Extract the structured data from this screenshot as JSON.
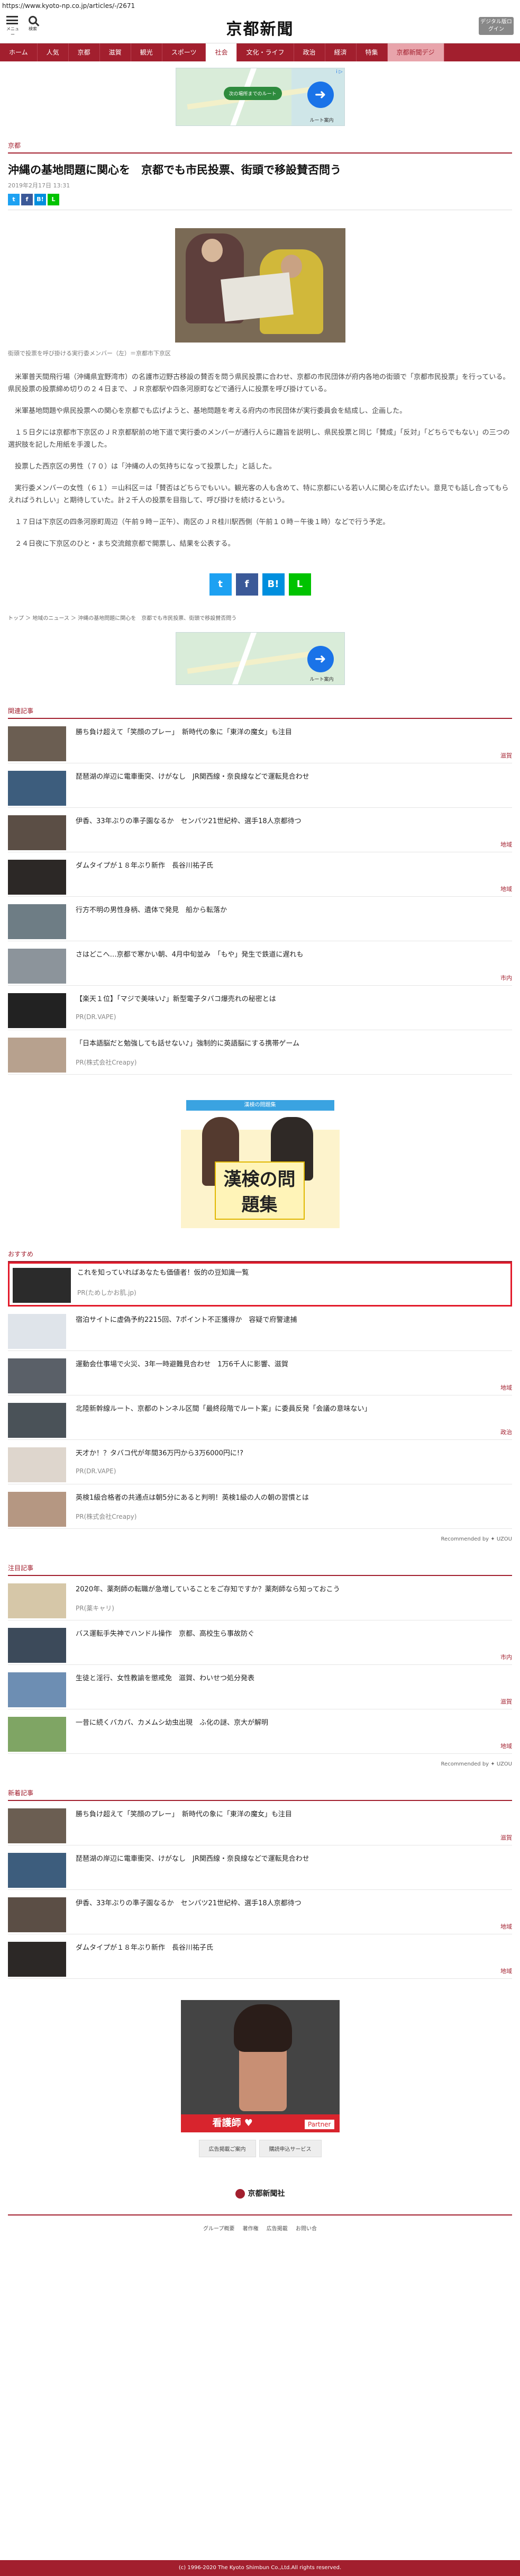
{
  "url": "https://www.kyoto-np.co.jp/articles/-/2671",
  "header": {
    "menu_label": "メニュー",
    "search_label": "検索",
    "logo": "京都新聞",
    "digital_label": "デジタル版ログイン"
  },
  "nav": [
    "ホーム",
    "人気",
    "京都",
    "滋賀",
    "観光",
    "スポーツ",
    "社会",
    "文化・ライフ",
    "政治",
    "経済",
    "特集",
    "京都新聞デジ"
  ],
  "ad_top": {
    "pill": "次の場所までのルート",
    "caption": "ルート案内",
    "info": "i ▷"
  },
  "section": "京都",
  "article": {
    "title": "沖縄の基地問題に関心を　京都でも市民投票、街頭で移設賛否問う",
    "date": "2019年2月17日 13:31",
    "caption": "街頭で投票を呼び掛ける実行委メンバー（左）＝京都市下京区",
    "paragraphs": [
      "米軍普天間飛行場（沖縄県宜野湾市）の名護市辺野古移設の賛否を問う県民投票に合わせ、京都の市民団体が府内各地の街頭で「京都市民投票」を行っている。県民投票の投票締め切りの２４日まで、ＪＲ京都駅や四条河原町などで通行人に投票を呼び掛けている。",
      "米軍基地問題や県民投票への関心を京都でも広げようと、基地問題を考える府内の市民団体が実行委員会を結成し、企画した。",
      "１５日夕には京都市下京区のＪＲ京都駅前の地下道で実行委のメンバーが通行人らに趣旨を説明し、県民投票と同じ「賛成」「反対」「どちらでもない」の三つの選択肢を記した用紙を手渡した。",
      "投票した西京区の男性（７０）は「沖縄の人の気持ちになって投票した」と話した。",
      "実行委メンバーの女性（６１）＝山科区＝は「賛否はどちらでもいい。観光客の人も含めて、特に京都にいる若い人に関心を広げたい。意見でも話し合ってもらえればうれしい」と期待していた。計２千人の投票を目指して、呼び掛けを続けるという。",
      "１７日は下京区の四条河原町周辺（午前９時－正午）、南区のＪＲ桂川駅西側（午前１０時－午後１時）などで行う予定。",
      "２４日夜に下京区のひと・まち交流館京都で開票し、結果を公表する。"
    ]
  },
  "breadcrumb": "トップ ＞ 地域のニュース ＞ 沖縄の基地問題に関心を　京都でも市民投票、街頭で移設賛否問う",
  "share": {
    "tw": "t",
    "fb": "f",
    "hb": "B!",
    "line": "L"
  },
  "related": {
    "heading": "関連記事",
    "items": [
      {
        "title": "勝ち負け超えて「笑顔のプレー」　新時代の象に「東洋の魔女」も注目",
        "tag": "滋賀"
      },
      {
        "title": "琵琶湖の岸辺に電車衝突、けがなし　JR関西線・奈良線などで運転見合わせ",
        "tag": ""
      },
      {
        "title": "伊香、33年ぶりの準子園なるか　センバツ21世紀枠、選手18人京都待つ",
        "tag": "地域"
      },
      {
        "title": "ダムタイプが１８年ぶり新作　長谷川祐子氏",
        "tag": "地域"
      },
      {
        "title": "行方不明の男性身柄、遺体で発見　船から転落か",
        "tag": ""
      },
      {
        "title": "さはどこへ…京都で寒かい朝、4月中旬並み　「もや」発生で鉄道に遅れも",
        "tag": "市内"
      }
    ],
    "pr": [
      {
        "title": "【楽天１位】「マジで美味い♪」新型電子タバコ爆売れの秘密とは",
        "sponsor": "PR(DR.VAPE)"
      },
      {
        "title": "「日本語脳だと勉強しても話せない♪」強制的に英語脳にする携帯ゲーム",
        "sponsor": "PR(株式会社Creapy)"
      }
    ]
  },
  "ad_kanken": {
    "top": "漢検の問題集",
    "book": "漢検の問題集"
  },
  "recommend": {
    "heading": "おすすめ",
    "items": [
      {
        "title": "これを知っていればあなたも価値者！仮的の豆知識一覧",
        "tag": "",
        "sponsor": "PR(ためしかお肌.jp)"
      },
      {
        "title": "宿泊サイトに虚偽予約2215回、7ポイント不正獲得か　容疑で府警逮捕",
        "tag": ""
      },
      {
        "title": "運動会仕事場で火災、3年一時避難見合わせ　1万6千人に影響、滋賀",
        "tag": "地域"
      },
      {
        "title": "北陸新幹線ルート、京都のトンネル区間「最終段階でルート案」に委員反発「会議の意味ない」",
        "tag": "政治"
      },
      {
        "title": "天才か！？タバコ代が年間36万円から3万6000円に!?",
        "tag": "",
        "sponsor": "PR(DR.VAPE)"
      },
      {
        "title": "英検1級合格者の共通点は朝5分にあると判明！英検1級の人の朝の習慣とは",
        "tag": "",
        "sponsor": "PR(株式会社Creapy)"
      }
    ],
    "recby": "Recommended by ✦ UZOU"
  },
  "attention": {
    "heading": "注目記事",
    "items": [
      {
        "title": "2020年、薬剤師の転職が急増していることをご存知ですか？薬剤師なら知っておこう",
        "tag": "",
        "sponsor": "PR(薬キャリ)"
      },
      {
        "title": "バス運転手失神でハンドル操作　京都、高校生ら事故防ぐ",
        "tag": "市内"
      },
      {
        "title": "生徒と淫行、女性教諭を懲戒免　滋賀、わいせつ処分発表",
        "tag": "滋賀"
      },
      {
        "title": "一昔に続くバカパ、カメムシ幼虫出現　ふ化の謎、京大が解明",
        "tag": "地域"
      }
    ],
    "recby": "Recommended by ✦ UZOU"
  },
  "newest": {
    "heading": "新着記事",
    "items": [
      {
        "title": "勝ち負け超えて「笑顔のプレー」　新時代の象に「東洋の魔女」も注目",
        "tag": "滋賀"
      },
      {
        "title": "琵琶湖の岸辺に電車衝突、けがなし　JR関西線・奈良線などで運転見合わせ",
        "tag": ""
      },
      {
        "title": "伊香、33年ぶりの準子園なるか　センバツ21世紀枠、選手18人京都待つ",
        "tag": "地域"
      },
      {
        "title": "ダムタイプが１８年ぶり新作　長谷川祐子氏",
        "tag": "地域"
      }
    ]
  },
  "ad_bottom": {
    "stripe": "看護師 ♥",
    "brand": "Partner"
  },
  "footer_buttons": [
    "広告掲載ご案内",
    "購読申込サービス"
  ],
  "footer_logo": "京都新聞社",
  "footer_links": [
    "グループ概要",
    "著作権",
    "広告掲載",
    "お問い合"
  ],
  "copyright": "(c) 1996-2020 The Kyoto Shimbun Co.,Ltd.All rights reserved."
}
